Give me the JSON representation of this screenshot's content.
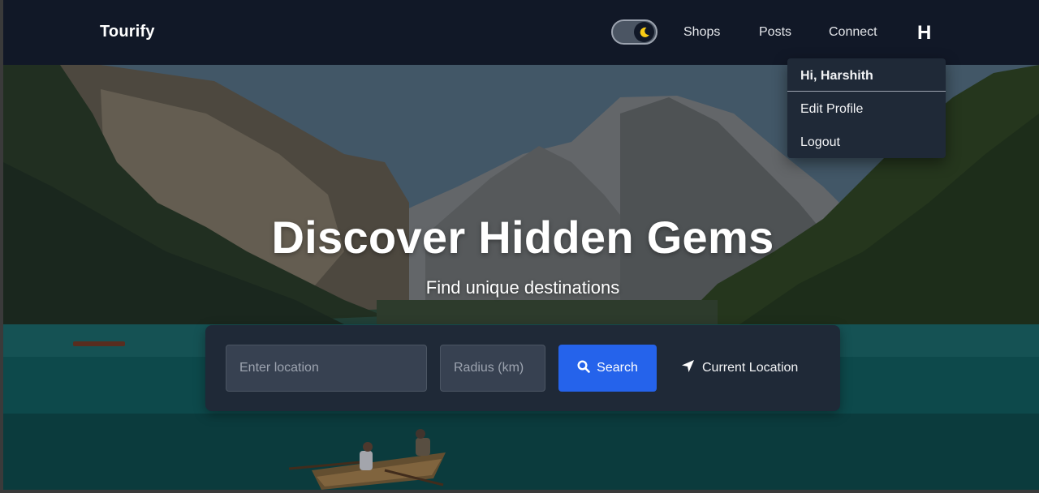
{
  "navbar": {
    "brand": "Tourify",
    "theme_toggle_icon": "moon-icon",
    "links": [
      "Shops",
      "Posts",
      "Connect"
    ],
    "avatar_initial": "H"
  },
  "profile_menu": {
    "greeting": "Hi, Harshith",
    "items": [
      "Edit Profile",
      "Logout"
    ]
  },
  "hero": {
    "title": "Discover Hidden Gems",
    "subtitle": "Find unique destinations"
  },
  "search": {
    "location_placeholder": "Enter location",
    "radius_placeholder": "Radius (km)",
    "search_label": "Search",
    "search_icon": "search-icon",
    "current_location_label": "Current Location",
    "current_location_icon": "location-arrow-icon"
  },
  "colors": {
    "navbar_bg": "#111827",
    "card_bg": "#1f2937",
    "accent": "#2563eb",
    "moon": "#facc15"
  }
}
